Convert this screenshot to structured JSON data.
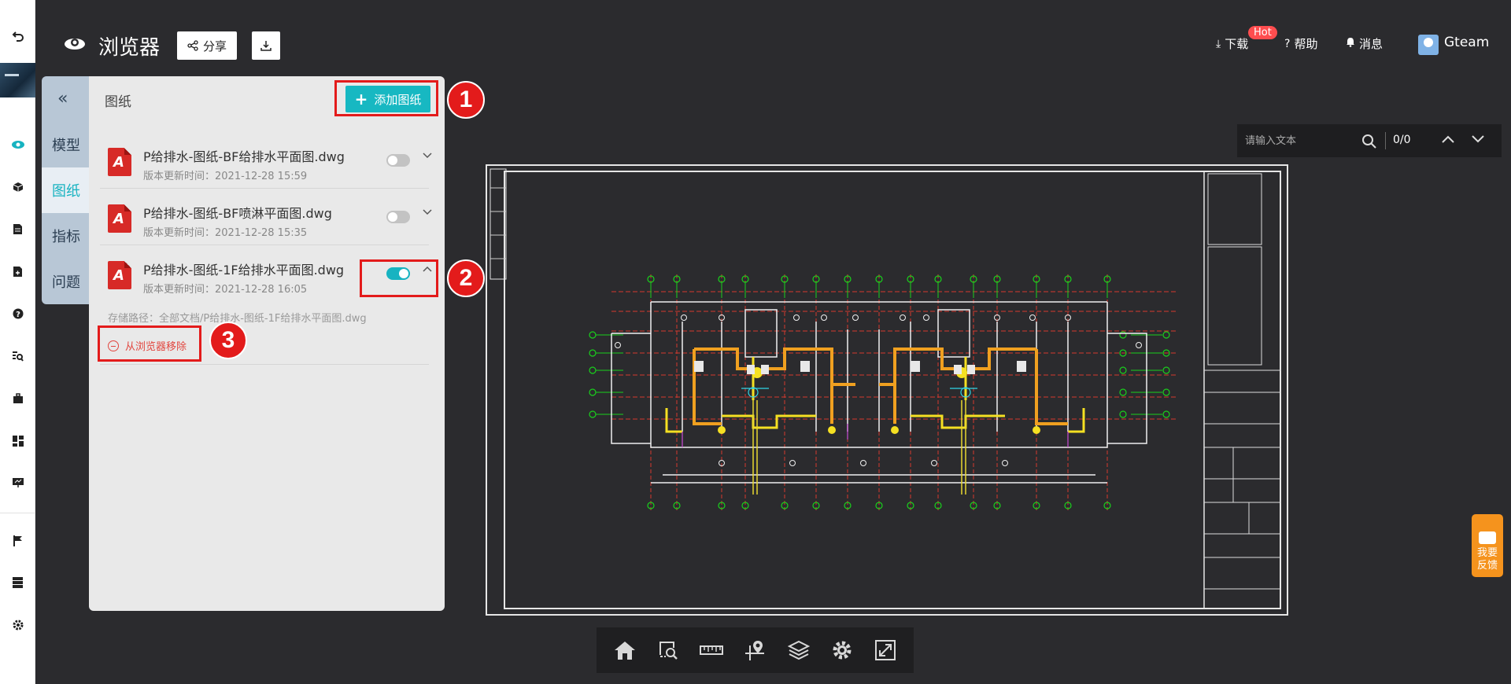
{
  "header": {
    "title": "浏览器",
    "share_label": "分享",
    "download_label": "下载",
    "hot_badge": "Hot",
    "help_label": "帮助",
    "messages_label": "消息",
    "username": "Gteam"
  },
  "side_tabs": [
    {
      "label": "模型",
      "active": false
    },
    {
      "label": "图纸",
      "active": true
    },
    {
      "label": "指标",
      "active": false
    },
    {
      "label": "问题",
      "active": false
    }
  ],
  "panel": {
    "title": "图纸",
    "add_button": "添加图纸",
    "files": [
      {
        "name": "P给排水-图纸-BF给排水平面图.dwg",
        "time": "版本更新时间：2021-12-28 15:59",
        "toggle": false,
        "expanded": false
      },
      {
        "name": "P给排水-图纸-BF喷淋平面图.dwg",
        "time": "版本更新时间：2021-12-28 15:35",
        "toggle": false,
        "expanded": false
      },
      {
        "name": "P给排水-图纸-1F给排水平面图.dwg",
        "time": "版本更新时间：2021-12-28 16:05",
        "toggle": true,
        "expanded": true
      }
    ],
    "storage_path": "存储路径：全部文档/P给排水-图纸-1F给排水平面图.dwg",
    "remove_label": "从浏览器移除"
  },
  "callouts": [
    "1",
    "2",
    "3"
  ],
  "search": {
    "placeholder": "请输入文本",
    "count": "0/0"
  },
  "feedback": {
    "line1": "我要",
    "line2": "反馈"
  },
  "colors": {
    "accent": "#17b3c1",
    "callout_red": "#e31b1b",
    "canvas": "#2b2b2e",
    "feedback": "#f5931d"
  },
  "icons": {
    "rail": [
      "back-icon",
      "eye-icon",
      "cube-icon",
      "document-icon",
      "file-plus-icon",
      "help-icon",
      "list-search-icon",
      "briefcase-icon",
      "dashboard-icon",
      "presentation-icon",
      "flag-icon",
      "table-icon",
      "gear-icon"
    ],
    "toolbar": [
      "home-icon",
      "zoom-window-icon",
      "ruler-icon",
      "pin-icon",
      "layers-icon",
      "settings-icon",
      "fullscreen-icon"
    ]
  }
}
